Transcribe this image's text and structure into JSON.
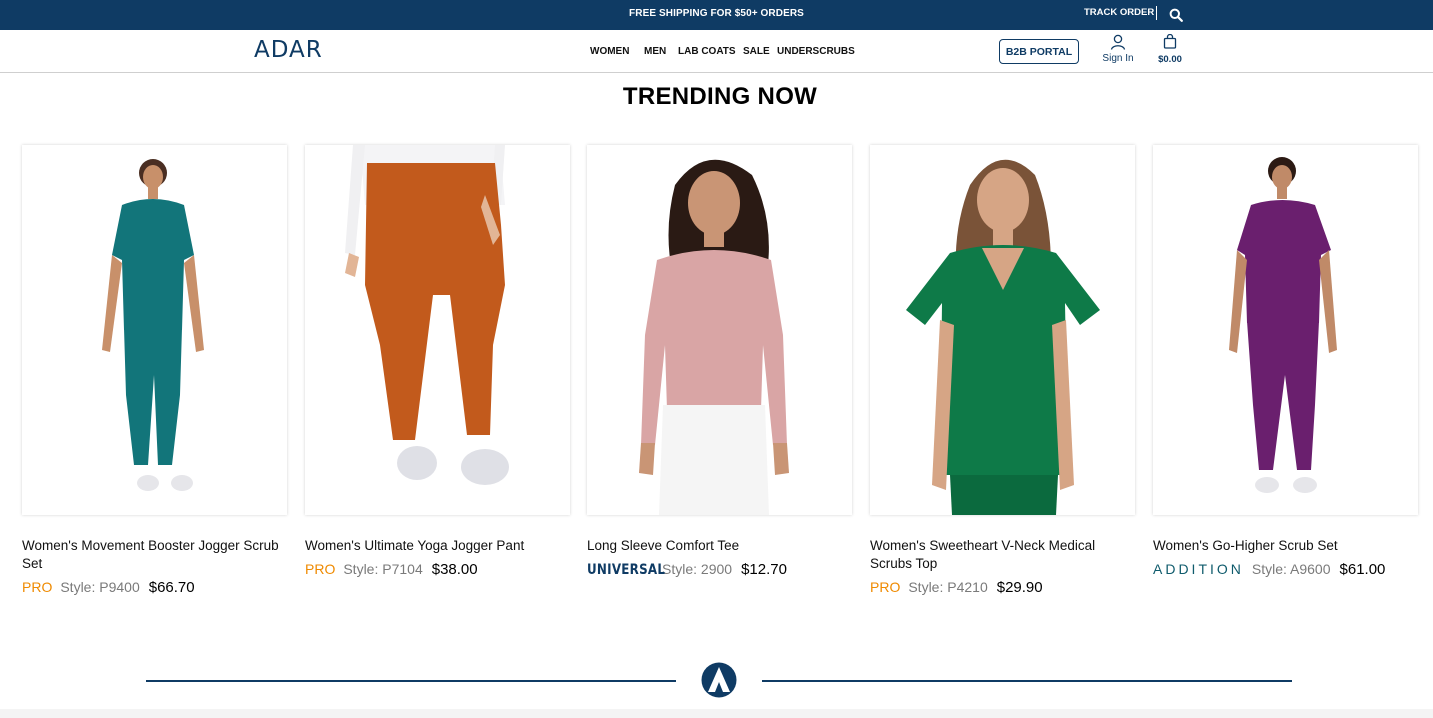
{
  "topbar": {
    "promo": "FREE SHIPPING FOR $50+ ORDERS",
    "track_order": "TRACK ORDER",
    "search_icon": "search-icon",
    "background": "#0f3b64"
  },
  "header": {
    "logo": "ADAR",
    "nav": [
      "WOMEN",
      "MEN",
      "LAB COATS",
      "SALE",
      "UNDERSCRUBS"
    ],
    "b2b_portal": "B2B PORTAL",
    "sign_in": "Sign In",
    "cart_total": "$0.00",
    "user_icon": "user-icon",
    "cart_icon": "shopping-bag-icon"
  },
  "section": {
    "title": "TRENDING NOW"
  },
  "products": [
    {
      "name": "Women's Movement Booster Jogger Scrub Set",
      "brand": "PRO",
      "style": "Style: P9400",
      "price": "$66.70",
      "color": "#12757a"
    },
    {
      "name": "Women's Ultimate Yoga Jogger Pant",
      "brand": "PRO",
      "style": "Style: P7104",
      "price": "$38.00",
      "color": "#c25a1c"
    },
    {
      "name": "Long Sleeve Comfort Tee",
      "brand": "UNIVERSAL",
      "style": "Style: 2900",
      "price": "$12.70",
      "color": "#d9a5a5"
    },
    {
      "name": "Women's Sweetheart V-Neck Medical Scrubs Top",
      "brand": "PRO",
      "style": "Style: P4210",
      "price": "$29.90",
      "color": "#0e7a48"
    },
    {
      "name": "Women's Go-Higher Scrub Set",
      "brand": "ADDITION",
      "style": "Style: A9600",
      "price": "$61.00",
      "color": "#6a1f6e"
    }
  ],
  "footer": {
    "emblem_icon": "adar-emblem-icon"
  }
}
